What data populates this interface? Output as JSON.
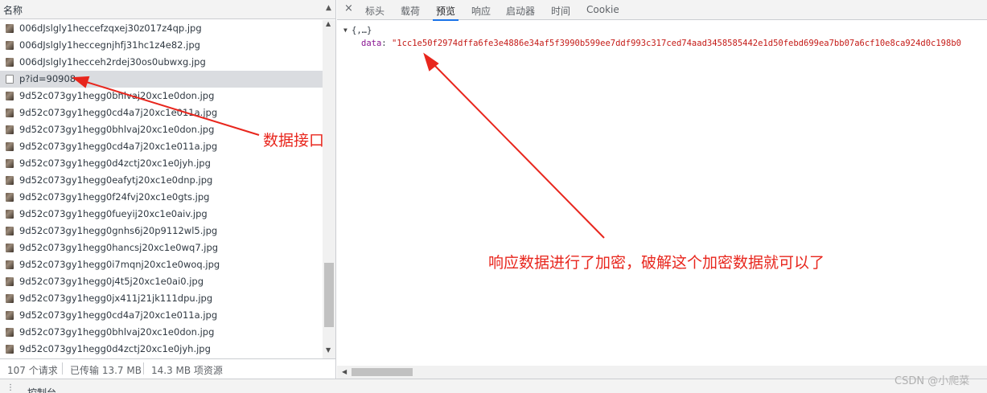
{
  "request_list": {
    "column_title": "名称",
    "rows": [
      {
        "name": "006dJslgly1heccefzqxej30z017z4qp.jpg",
        "type": "img"
      },
      {
        "name": "006dJslgly1heccegnjhfj31hc1z4e82.jpg",
        "type": "img"
      },
      {
        "name": "006dJslgly1hecceh2rdej30os0ubwxg.jpg",
        "type": "img"
      },
      {
        "name": "p?id=90908",
        "type": "doc",
        "selected": true
      },
      {
        "name": "9d52c073gy1hegg0bhlvaj20xc1e0don.jpg",
        "type": "img"
      },
      {
        "name": "9d52c073gy1hegg0cd4a7j20xc1e011a.jpg",
        "type": "img"
      },
      {
        "name": "9d52c073gy1hegg0bhlvaj20xc1e0don.jpg",
        "type": "img"
      },
      {
        "name": "9d52c073gy1hegg0cd4a7j20xc1e011a.jpg",
        "type": "img"
      },
      {
        "name": "9d52c073gy1hegg0d4zctj20xc1e0jyh.jpg",
        "type": "img"
      },
      {
        "name": "9d52c073gy1hegg0eafytj20xc1e0dnp.jpg",
        "type": "img"
      },
      {
        "name": "9d52c073gy1hegg0f24fvj20xc1e0gts.jpg",
        "type": "img"
      },
      {
        "name": "9d52c073gy1hegg0fueyij20xc1e0aiv.jpg",
        "type": "img"
      },
      {
        "name": "9d52c073gy1hegg0gnhs6j20p9112wl5.jpg",
        "type": "img"
      },
      {
        "name": "9d52c073gy1hegg0hancsj20xc1e0wq7.jpg",
        "type": "img"
      },
      {
        "name": "9d52c073gy1hegg0i7mqnj20xc1e0woq.jpg",
        "type": "img"
      },
      {
        "name": "9d52c073gy1hegg0j4t5j20xc1e0ai0.jpg",
        "type": "img"
      },
      {
        "name": "9d52c073gy1hegg0jx411j21jk111dpu.jpg",
        "type": "img"
      },
      {
        "name": "9d52c073gy1hegg0cd4a7j20xc1e011a.jpg",
        "type": "img"
      },
      {
        "name": "9d52c073gy1hegg0bhlvaj20xc1e0don.jpg",
        "type": "img"
      },
      {
        "name": "9d52c073gy1hegg0d4zctj20xc1e0jyh.jpg",
        "type": "img"
      }
    ]
  },
  "status_bar": {
    "requests": "107 个请求",
    "transferred": "已传输 13.7 MB",
    "resources": "14.3 MB 项资源"
  },
  "tabs": {
    "close_symbol": "×",
    "items": [
      "标头",
      "载荷",
      "预览",
      "响应",
      "启动器",
      "时间",
      "Cookie"
    ],
    "active": "预览"
  },
  "preview": {
    "summary": "{,…}",
    "key": "data",
    "value": "\"1cc1e50f2974dffa6fe3e4886e34af5f3990b599ee7ddf993c317ced74aad3458585442e1d50febd699ea7bb07a6cf10e8ca924d0c198b0"
  },
  "drawer": {
    "menu_symbol": "⋮",
    "tab_label": "控制台"
  },
  "annotations": {
    "api_label": "数据接口",
    "response_label": "响应数据进行了加密，破解这个加密数据就可以了",
    "color": "#e8261d"
  },
  "watermark": "CSDN @小爬菜"
}
